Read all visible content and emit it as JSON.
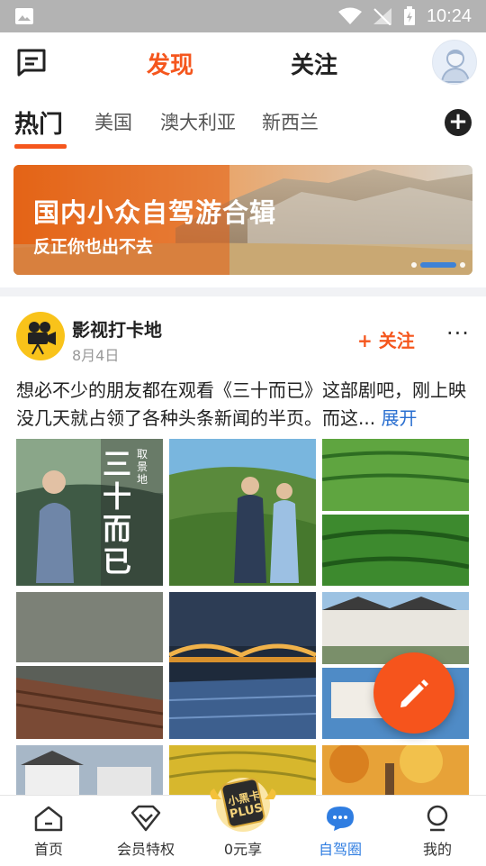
{
  "status_bar": {
    "time": "10:24"
  },
  "header": {
    "tabs": [
      {
        "label": "发现",
        "active": true
      },
      {
        "label": "关注",
        "active": false
      }
    ],
    "accent_color": "#f5561d"
  },
  "sub_tabs": {
    "items": [
      "热门",
      "美国",
      "澳大利亚",
      "新西兰"
    ],
    "active_index": 0
  },
  "banner": {
    "title": "国内小众自驾游合辑",
    "subtitle": "反正你也出不去",
    "slides": 3,
    "active_slide": 1
  },
  "post": {
    "author": "影视打卡地",
    "date": "8月4日",
    "follow_label": "+ 关注",
    "more_label": "···",
    "text": "想必不少的朋友都在观看《三十而已》这部剧吧，刚上映没几天就占领了各种头条新闻的半页。而这... ",
    "expand_label": "展开",
    "photo_overlay_text": "三十而已",
    "photo_overlay_small": "取景地"
  },
  "bottom_nav": {
    "items": [
      {
        "label": "首页",
        "icon": "home-icon"
      },
      {
        "label": "会员特权",
        "icon": "diamond-icon"
      },
      {
        "label": "0元享",
        "icon": "plus-card-badge"
      },
      {
        "label": "自驾圈",
        "icon": "chat-bubble-icon"
      },
      {
        "label": "我的",
        "icon": "profile-icon"
      }
    ],
    "active_index": 3,
    "badge_line1": "小黑卡",
    "badge_line2": "PLUS"
  }
}
